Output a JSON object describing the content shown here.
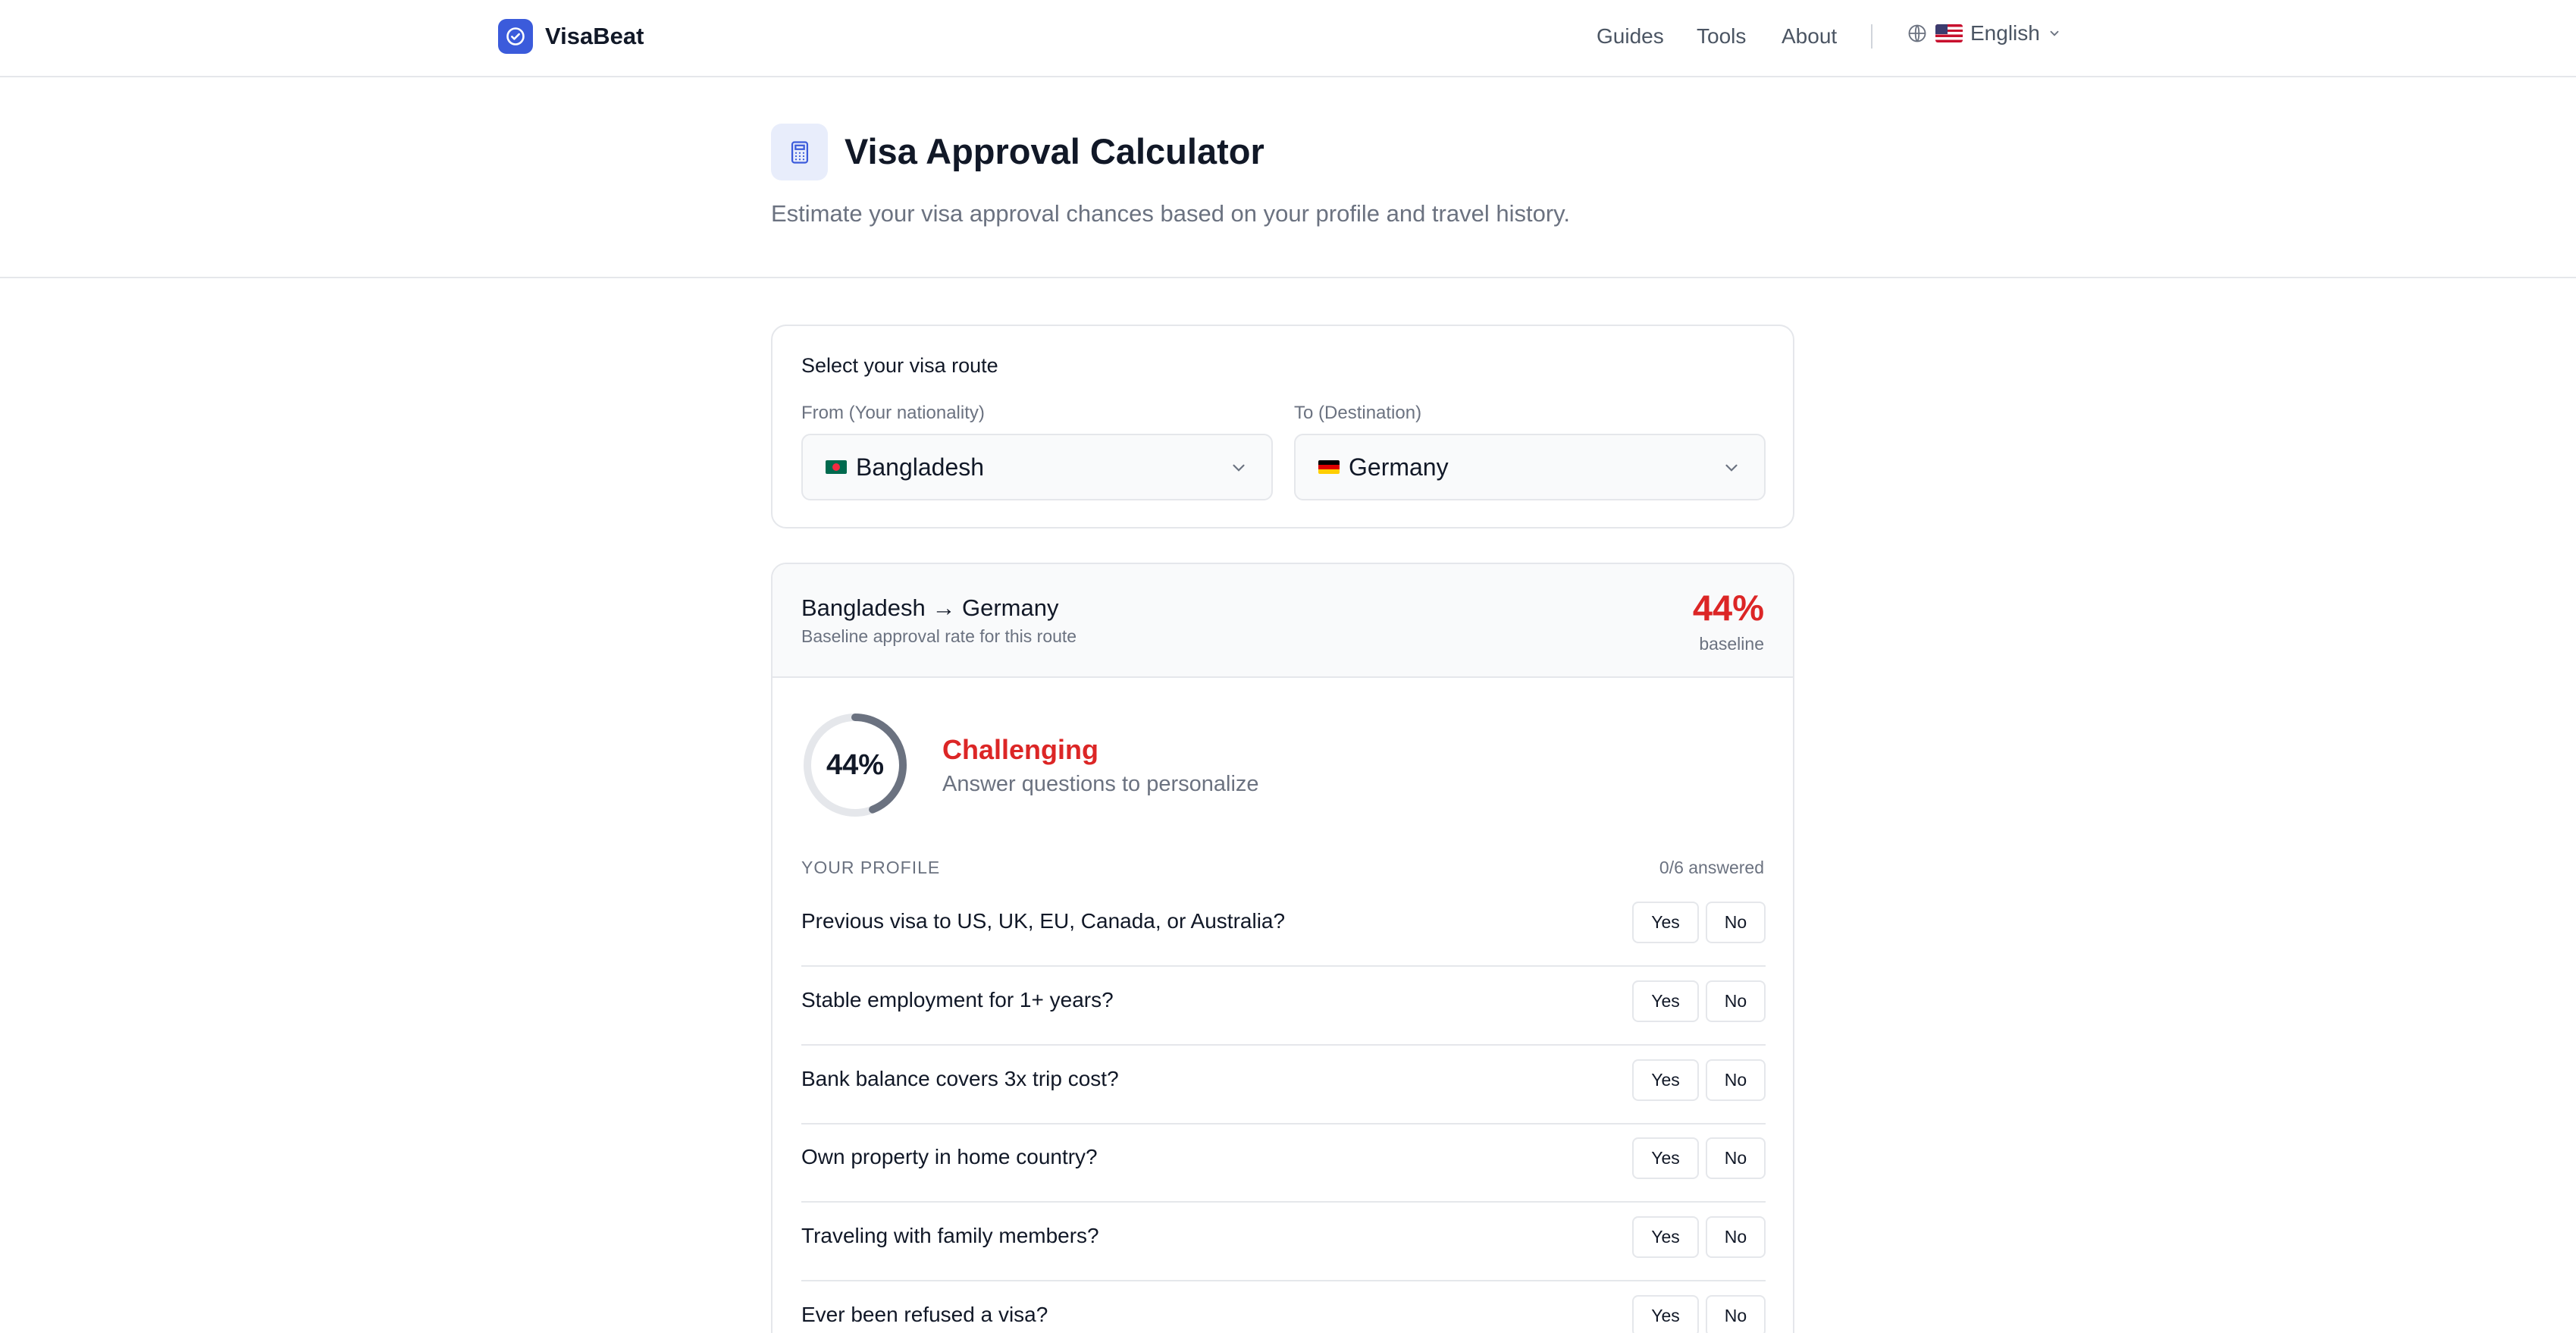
{
  "nav": {
    "brand": "VisaBeat",
    "links": [
      "Guides",
      "Tools",
      "About"
    ],
    "language": "English"
  },
  "hero": {
    "title": "Visa Approval Calculator",
    "subtitle": "Estimate your visa approval chances based on your profile and travel history."
  },
  "route": {
    "heading": "Select your visa route",
    "from_label": "From (Your nationality)",
    "from_value": "Bangladesh",
    "to_label": "To (Destination)",
    "to_value": "Germany"
  },
  "result": {
    "route_name": "Bangladesh → Germany",
    "route_sub": "Baseline approval rate for this route",
    "baseline_pct": "44%",
    "baseline_label": "baseline",
    "gauge_pct": "44%",
    "gauge_value": 0.44,
    "verdict": "Challenging",
    "verdict_sub": "Answer questions to personalize",
    "profile_label": "YOUR PROFILE",
    "answered": "0/6 answered",
    "yes_label": "Yes",
    "no_label": "No",
    "questions": [
      "Previous visa to US, UK, EU, Canada, or Australia?",
      "Stable employment for 1+ years?",
      "Bank balance covers 3x trip cost?",
      "Own property in home country?",
      "Traveling with family members?",
      "Ever been refused a visa?"
    ]
  },
  "colors": {
    "accent": "#3b5bdb",
    "danger": "#dc2626",
    "gauge_track": "#e5e7eb",
    "gauge_fill": "#6b7280"
  }
}
